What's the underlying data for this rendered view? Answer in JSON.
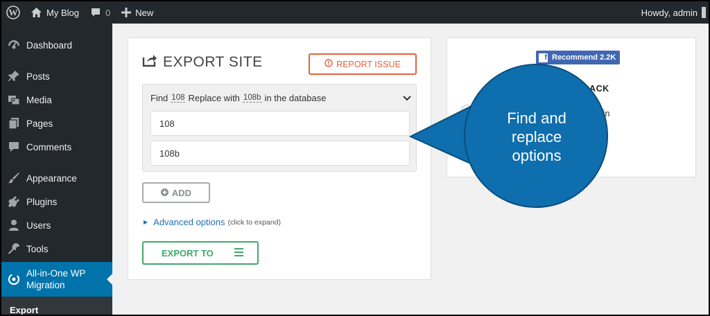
{
  "adminbar": {
    "site_name": "My Blog",
    "comment_count": "0",
    "new_label": "New",
    "howdy": "Howdy, admin"
  },
  "sidebar": {
    "items": [
      {
        "label": "Dashboard",
        "icon": "dashboard-icon"
      },
      {
        "label": "Posts",
        "icon": "pin-icon"
      },
      {
        "label": "Media",
        "icon": "media-icon"
      },
      {
        "label": "Pages",
        "icon": "pages-icon"
      },
      {
        "label": "Comments",
        "icon": "comment-icon"
      },
      {
        "label": "Appearance",
        "icon": "brush-icon"
      },
      {
        "label": "Plugins",
        "icon": "plugin-icon"
      },
      {
        "label": "Users",
        "icon": "user-icon"
      },
      {
        "label": "Tools",
        "icon": "wrench-icon"
      },
      {
        "label": "All-in-One WP Migration",
        "icon": "migration-icon"
      }
    ],
    "submenu": {
      "label": "Export"
    }
  },
  "export": {
    "title": "EXPORT SITE",
    "report_label": "REPORT ISSUE",
    "find_replace": {
      "find_word": "Find",
      "find_value": "108",
      "replace_word": "Replace with",
      "replace_value": "108b",
      "suffix": "in the database"
    },
    "find_input": "108",
    "replace_input": "108b",
    "add_label": "ADD",
    "advanced_label": "Advanced options",
    "advanced_hint": "(click to expand)",
    "export_to_label": "EXPORT TO"
  },
  "side_panel": {
    "fb_recommend": "Recommend 2.2K",
    "heading_fragment": "DBACK",
    "text_fragment": "lugin"
  },
  "callout": {
    "lines": [
      "Find and",
      "replace",
      "options"
    ],
    "color": "#0f6ead"
  },
  "colors": {
    "adminbar_bg": "#23282d",
    "active_menu": "#0073aa",
    "report_orange": "#e0623d",
    "export_green": "#3fa86a",
    "link_blue": "#2271b1",
    "facebook_blue": "#4267b2"
  }
}
